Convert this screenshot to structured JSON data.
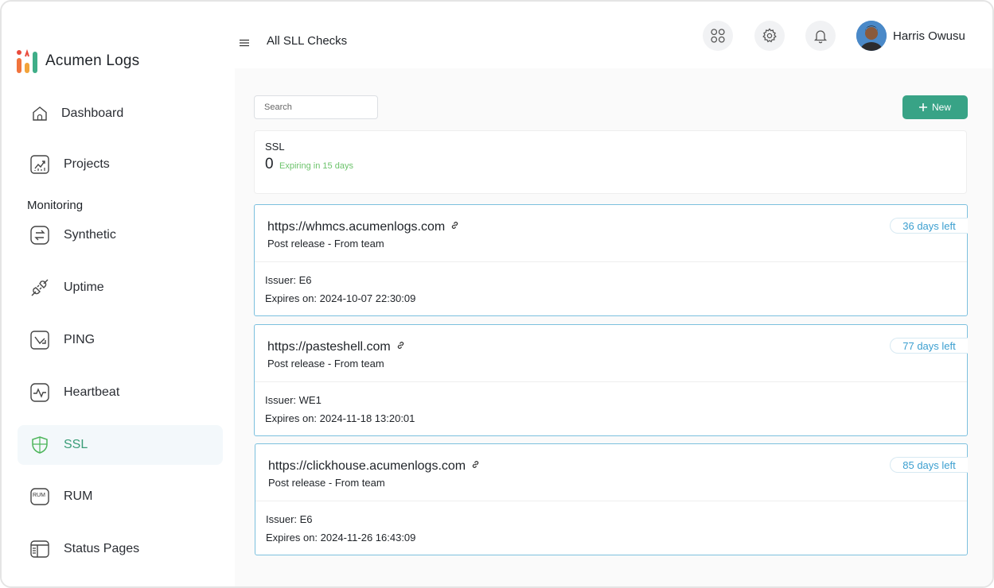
{
  "app": {
    "name": "Acumen Logs"
  },
  "header": {
    "title": "All SLL Checks",
    "user_name": "Harris Owusu",
    "icons": [
      "menu-icon",
      "apps-grid-icon",
      "gear-icon",
      "bell-icon"
    ]
  },
  "sidebar": {
    "items": [
      {
        "label": "Dashboard",
        "icon": "home-icon"
      },
      {
        "label": "Projects",
        "icon": "chart-icon"
      },
      {
        "label": "Synthetic",
        "icon": "swap-icon"
      },
      {
        "label": "Uptime",
        "icon": "plug-icon"
      },
      {
        "label": "PING",
        "icon": "ping-icon"
      },
      {
        "label": "Heartbeat",
        "icon": "pulse-icon"
      },
      {
        "label": "SSL",
        "icon": "shield-icon",
        "active": true
      },
      {
        "label": "RUM",
        "icon": "rum-icon",
        "icon_text": "RUM"
      },
      {
        "label": "Status Pages",
        "icon": "status-page-icon"
      }
    ],
    "section_label": "Monitoring"
  },
  "toolbar": {
    "search_placeholder": "Search",
    "new_label": "New"
  },
  "summary": {
    "label": "SSL",
    "count": "0",
    "expiring_text": "Expiring in 15 days"
  },
  "checks": [
    {
      "url": "https://whmcs.acumenlogs.com",
      "subtitle": "Post release - From team",
      "issuer": "Issuer: E6",
      "expires": "Expires on: 2024-10-07 22:30:09",
      "days_left": "36 days left"
    },
    {
      "url": "https://pasteshell.com",
      "subtitle": "Post release - From team",
      "issuer": "Issuer: WE1",
      "expires": "Expires on: 2024-11-18 13:20:01",
      "days_left": "77 days left"
    },
    {
      "url": "https://clickhouse.acumenlogs.com",
      "subtitle": "Post release - From team",
      "issuer": "Issuer: E6",
      "expires": "Expires on: 2024-11-26 16:43:09",
      "days_left": "85 days left"
    }
  ],
  "colors": {
    "accent": "#38a386",
    "badge_text": "#3c9fd0",
    "card_border": "#7cc0de",
    "expiring": "#6cc36b"
  }
}
